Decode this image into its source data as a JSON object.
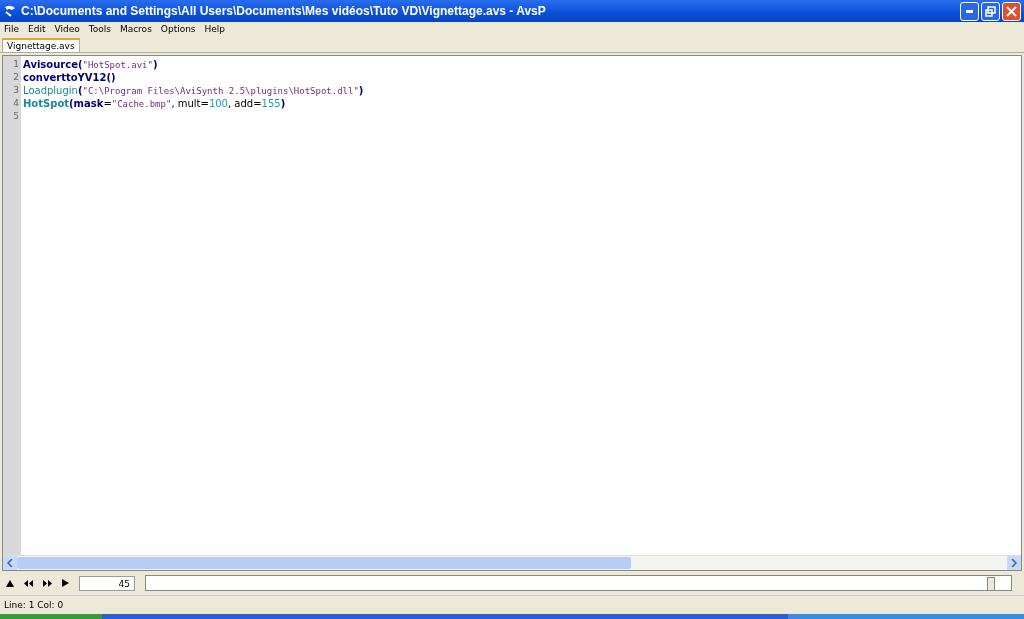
{
  "window": {
    "title": "C:\\Documents and Settings\\All Users\\Documents\\Mes vidéos\\Tuto VD\\Vignettage.avs - AvsP"
  },
  "menu": [
    "File",
    "Edit",
    "Video",
    "Tools",
    "Macros",
    "Options",
    "Help"
  ],
  "tabs": [
    {
      "label": "Vignettage.avs",
      "selected": true
    }
  ],
  "editor": {
    "lines": [
      {
        "number": "1",
        "tokens": [
          {
            "kind": "keyword",
            "text": "Avisource("
          },
          {
            "kind": "string",
            "text": "\"HotSpot.avi\""
          },
          {
            "kind": "keyword",
            "text": ")"
          }
        ]
      },
      {
        "number": "2",
        "tokens": [
          {
            "kind": "keyword",
            "text": "converttoYV12()"
          }
        ]
      },
      {
        "number": "3",
        "tokens": [
          {
            "kind": "builtin",
            "text": "Loadplugin"
          },
          {
            "kind": "keyword",
            "text": "("
          },
          {
            "kind": "string",
            "text": "\"C:\\Program Files\\AviSynth 2.5\\plugins\\HotSpot.dll\""
          },
          {
            "kind": "keyword",
            "text": ")"
          }
        ]
      },
      {
        "number": "4",
        "tokens": [
          {
            "kind": "plugin",
            "text": "HotSpot"
          },
          {
            "kind": "keyword",
            "text": "(mask"
          },
          {
            "kind": "text",
            "text": "="
          },
          {
            "kind": "string",
            "text": "\"Cache.bmp\""
          },
          {
            "kind": "text",
            "text": ", mult="
          },
          {
            "kind": "number",
            "text": "100"
          },
          {
            "kind": "text",
            "text": ", add="
          },
          {
            "kind": "number",
            "text": "155"
          },
          {
            "kind": "keyword",
            "text": ")"
          }
        ]
      },
      {
        "number": "5"
      }
    ]
  },
  "toolbar": {
    "frame": "45",
    "slider": {
      "level": 0.978
    }
  },
  "status_bar": "Line: 1  Col: 0"
}
